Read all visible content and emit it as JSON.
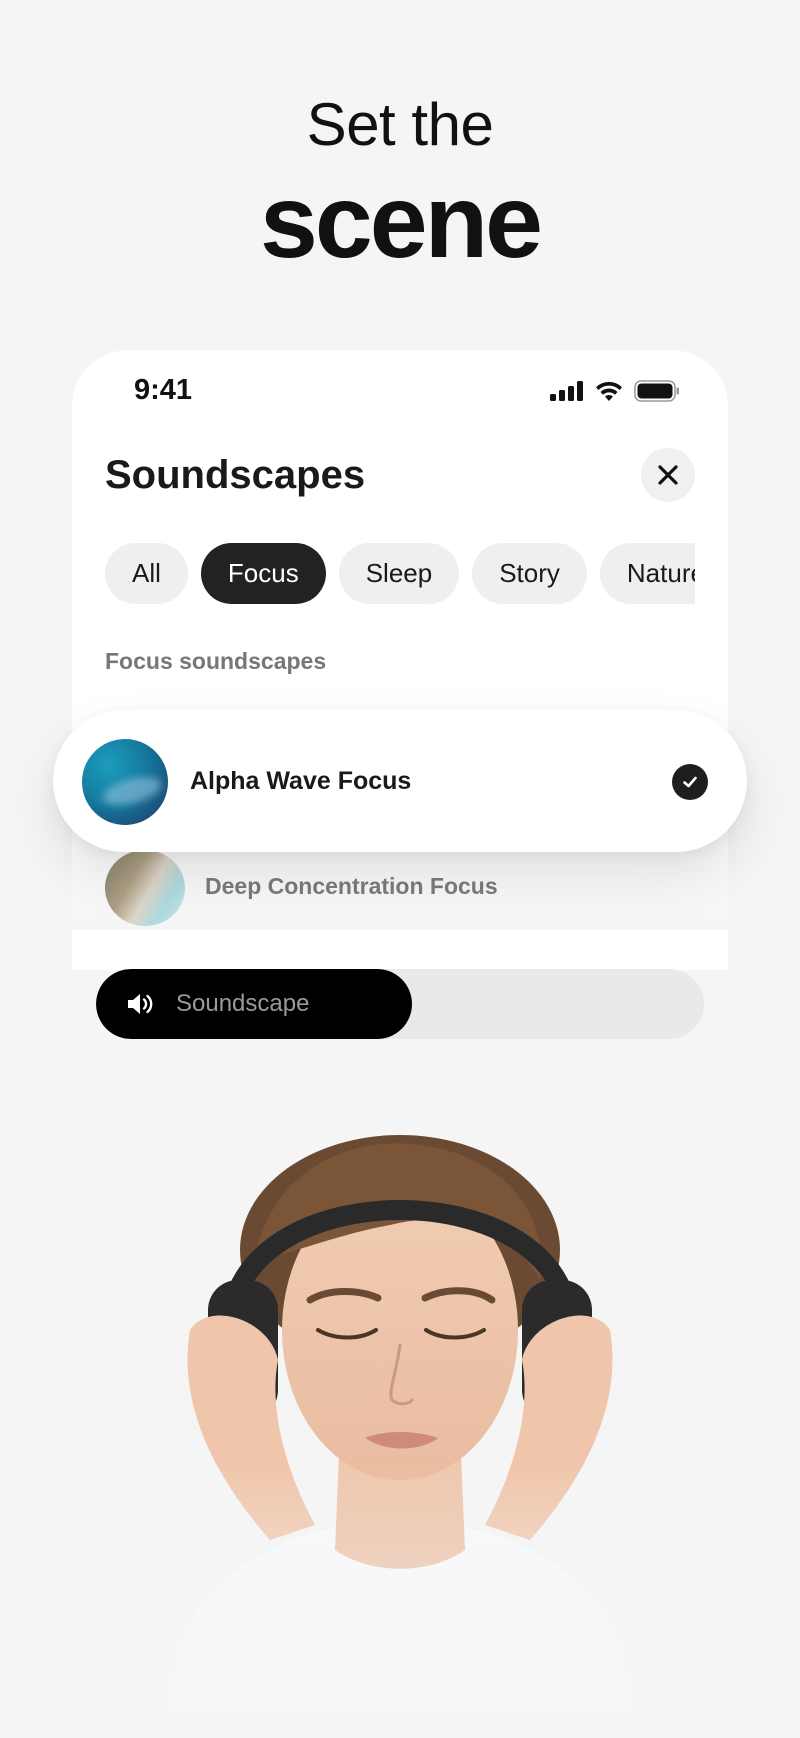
{
  "headline": {
    "line1": "Set the",
    "line2": "scene"
  },
  "status_bar": {
    "time": "9:41",
    "icons": [
      "signal-icon",
      "wifi-icon",
      "battery-icon"
    ]
  },
  "sheet": {
    "title": "Soundscapes",
    "close_icon": "close-icon",
    "filters": [
      {
        "label": "All",
        "active": false
      },
      {
        "label": "Focus",
        "active": true
      },
      {
        "label": "Sleep",
        "active": false
      },
      {
        "label": "Story",
        "active": false
      },
      {
        "label": "Nature",
        "active": false
      }
    ],
    "section_label": "Focus soundscapes",
    "items": [
      {
        "label": "Alpha Wave Focus",
        "selected": true
      },
      {
        "label": "Deep Concentration Focus",
        "selected": false
      }
    ]
  },
  "volume": {
    "label": "Soundscape",
    "icon": "speaker-icon",
    "level": 0.52
  },
  "colors": {
    "accent": "#000000",
    "chip_active": "#222222",
    "chip": "#efefef",
    "background": "#f5f5f5"
  }
}
